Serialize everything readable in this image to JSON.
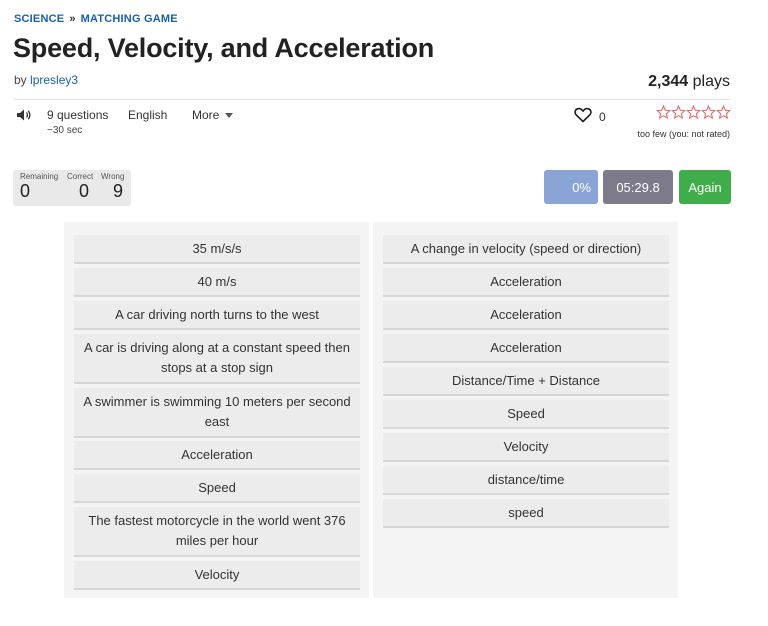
{
  "breadcrumb": {
    "category": "SCIENCE",
    "separator": "»",
    "type": "MATCHING GAME"
  },
  "title": "Speed, Velocity, and Acceleration",
  "byline": {
    "prefix": "by",
    "author": "lpresley3"
  },
  "plays": {
    "count": "2,344",
    "label": "plays"
  },
  "meta": {
    "questions": "9 questions",
    "duration": "~30 sec",
    "language": "English",
    "more": "More"
  },
  "favorites": {
    "count": "0"
  },
  "rating": {
    "note": "too few (you: not rated)",
    "stars": 5,
    "filled": 0,
    "color": "#e06666"
  },
  "score": {
    "remaining_label": "Remaining",
    "correct_label": "Correct",
    "wrong_label": "Wrong",
    "remaining": "0",
    "correct": "0",
    "wrong": "9"
  },
  "controls": {
    "progress": "0%",
    "timer": "05:29.8",
    "again": "Again"
  },
  "left_items": [
    "35 m/s/s",
    "40 m/s",
    "A car driving north turns to the west",
    "A car is driving along at a constant speed then stops at a stop sign",
    "A swimmer is swimming 10 meters per second east",
    "Acceleration",
    "Speed",
    "The fastest motorcycle in the world went 376 miles per hour",
    "Velocity"
  ],
  "right_items": [
    "A change in velocity (speed or direction)",
    "Acceleration",
    "Acceleration",
    "Acceleration",
    "Distance/Time + Distance",
    "Speed",
    "Velocity",
    "distance/time",
    "speed"
  ]
}
